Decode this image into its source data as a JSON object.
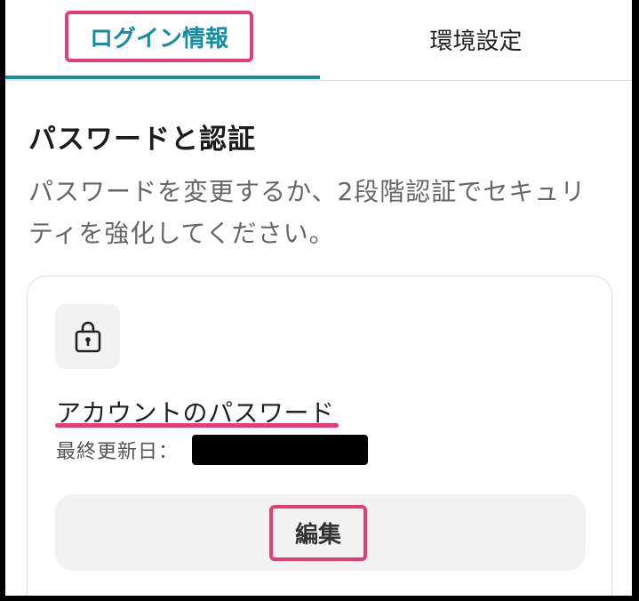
{
  "tabs": [
    {
      "label": "ログイン情報",
      "active": true
    },
    {
      "label": "環境設定",
      "active": false
    }
  ],
  "section": {
    "title": "パスワードと認証",
    "description_line1": "パスワードを変更するか、2段階認証でセキュリ",
    "description_line2": "ティを強化してください。"
  },
  "card": {
    "icon": "lock-icon",
    "title": "アカウントのパスワード",
    "updated_label": "最終更新日：",
    "edit_label": "編集"
  },
  "colors": {
    "accent": "#198ca1",
    "highlight": "#e63c72"
  }
}
